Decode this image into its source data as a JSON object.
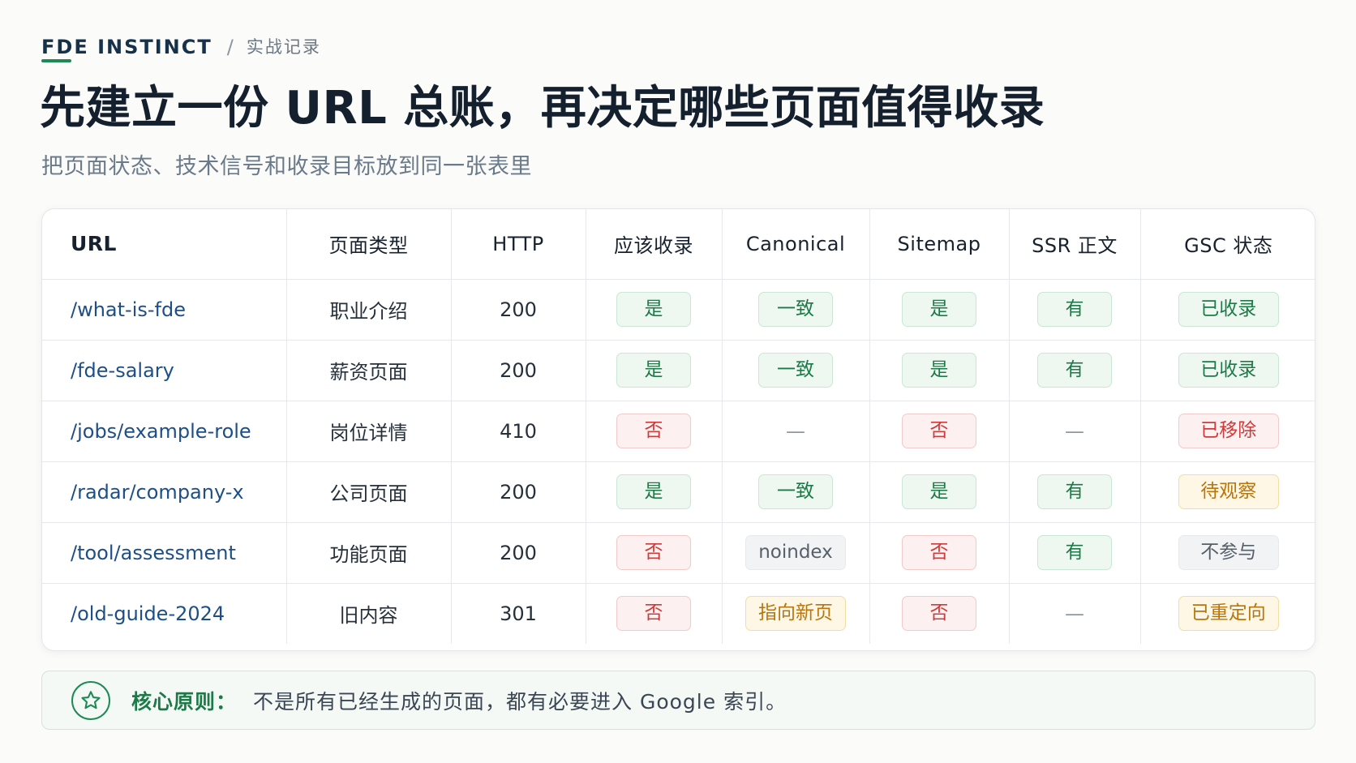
{
  "header": {
    "brand": "FDE INSTINCT",
    "separator": "/",
    "section": "实战记录",
    "title": "先建立一份 URL 总账，再决定哪些页面值得收录",
    "subtitle": "把页面状态、技术信号和收录目标放到同一张表里"
  },
  "table": {
    "columns": [
      "URL",
      "页面类型",
      "HTTP",
      "应该收录",
      "Canonical",
      "Sitemap",
      "SSR 正文",
      "GSC 状态"
    ],
    "rows": [
      {
        "url": "/what-is-fde",
        "type": "职业介绍",
        "http": "200",
        "index": "是",
        "canonical": "一致",
        "sitemap": "是",
        "ssr": "有",
        "gsc": "已收录"
      },
      {
        "url": "/fde-salary",
        "type": "薪资页面",
        "http": "200",
        "index": "是",
        "canonical": "一致",
        "sitemap": "是",
        "ssr": "有",
        "gsc": "已收录"
      },
      {
        "url": "/jobs/example-role",
        "type": "岗位详情",
        "http": "410",
        "index": "否",
        "canonical": "—",
        "sitemap": "否",
        "ssr": "—",
        "gsc": "已移除"
      },
      {
        "url": "/radar/company-x",
        "type": "公司页面",
        "http": "200",
        "index": "是",
        "canonical": "一致",
        "sitemap": "是",
        "ssr": "有",
        "gsc": "待观察"
      },
      {
        "url": "/tool/assessment",
        "type": "功能页面",
        "http": "200",
        "index": "否",
        "canonical": "noindex",
        "sitemap": "否",
        "ssr": "有",
        "gsc": "不参与"
      },
      {
        "url": "/old-guide-2024",
        "type": "旧内容",
        "http": "301",
        "index": "否",
        "canonical": "指向新页",
        "sitemap": "否",
        "ssr": "—",
        "gsc": "已重定向"
      }
    ]
  },
  "banner": {
    "icon": "star-icon",
    "label": "核心原则：",
    "text": "不是所有已经生成的页面，都有必要进入 Google 索引。"
  },
  "colors": {
    "accent": "#1d8a56",
    "positive": "#1d7a48",
    "negative": "#cf3b3b",
    "warning": "#b8750c",
    "neutral": "#55606b",
    "link": "#1d4f86"
  }
}
